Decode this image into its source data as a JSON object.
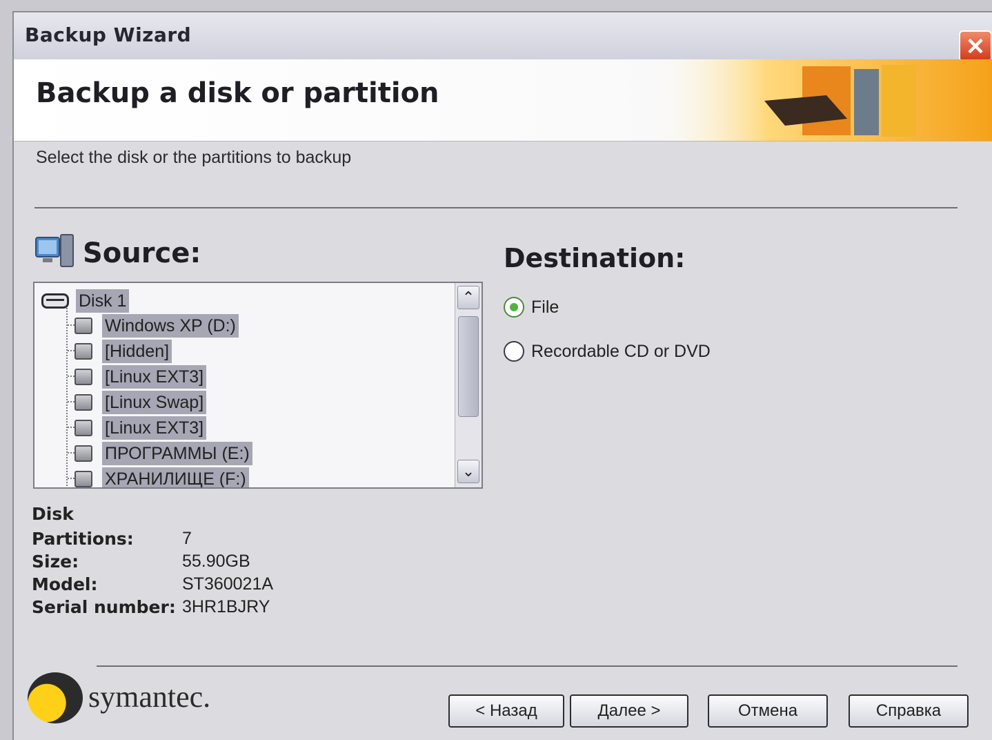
{
  "window": {
    "title": "Backup Wizard",
    "close_symbol": "✕"
  },
  "header": {
    "title": "Backup a disk or partition"
  },
  "instruction": "Select the disk or the partitions to backup",
  "source": {
    "label": "Source:",
    "icon": "computer-icon",
    "tree": {
      "disk": "Disk 1",
      "partitions": [
        "Windows XP (D:)",
        "[Hidden]",
        "[Linux EXT3]",
        "[Linux Swap]",
        "[Linux EXT3]",
        "ПРОГРАММЫ (E:)",
        "ХРАНИЛИЩЕ (F:)"
      ]
    },
    "scroll_up": "⌃",
    "scroll_down": "⌄"
  },
  "destination": {
    "label": "Destination:",
    "options": [
      {
        "label": "File",
        "selected": true
      },
      {
        "label": "Recordable CD or DVD",
        "selected": false
      }
    ]
  },
  "disk_info": {
    "heading": "Disk",
    "partitions_label": "Partitions:",
    "partitions_value": "7",
    "size_label": "Size:",
    "size_value": "55.90GB",
    "model_label": "Model:",
    "model_value": "ST360021A",
    "serial_label": "Serial number:",
    "serial_value": "3HR1BJRY"
  },
  "brand": {
    "name": "symantec."
  },
  "buttons": {
    "back": "< Назад",
    "next": "Далее >",
    "cancel": "Отмена",
    "help": "Справка"
  },
  "colors": {
    "selection": "#a7a6b4",
    "radio_accent": "#4fb43c",
    "logo_yellow": "#ffd018"
  }
}
